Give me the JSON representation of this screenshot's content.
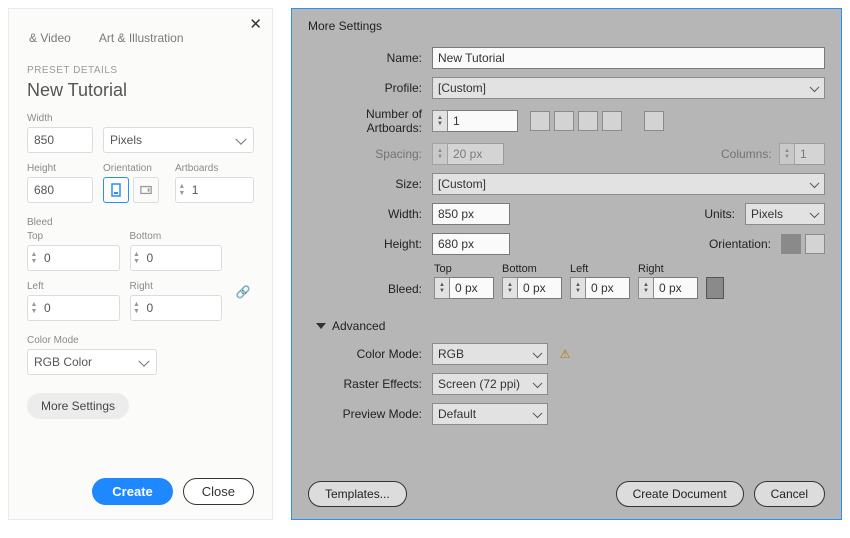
{
  "left": {
    "tabs": {
      "video": "& Video",
      "art": "Art & Illustration"
    },
    "preset_label": "PRESET DETAILS",
    "doc_name": "New Tutorial",
    "width_label": "Width",
    "width_value": "850",
    "units_value": "Pixels",
    "height_label": "Height",
    "height_value": "680",
    "orientation_label": "Orientation",
    "artboards_label": "Artboards",
    "artboards_value": "1",
    "bleed_label": "Bleed",
    "top_label": "Top",
    "top_value": "0",
    "bottom_label": "Bottom",
    "bottom_value": "0",
    "left_label": "Left",
    "left_value": "0",
    "right_label": "Right",
    "right_value": "0",
    "color_mode_label": "Color Mode",
    "color_mode_value": "RGB Color",
    "more_settings": "More Settings",
    "create_btn": "Create",
    "close_btn": "Close"
  },
  "right": {
    "title": "More Settings",
    "name_label": "Name:",
    "name_value": "New Tutorial",
    "profile_label": "Profile:",
    "profile_value": "[Custom]",
    "num_artboards_label": "Number of Artboards:",
    "num_artboards_value": "1",
    "spacing_label": "Spacing:",
    "spacing_value": "20 px",
    "columns_label": "Columns:",
    "columns_value": "1",
    "size_label": "Size:",
    "size_value": "[Custom]",
    "width_label": "Width:",
    "width_value": "850 px",
    "units_label": "Units:",
    "units_value": "Pixels",
    "height_label": "Height:",
    "height_value": "680 px",
    "orientation_label": "Orientation:",
    "bleed_label": "Bleed:",
    "top_label": "Top",
    "top_value": "0 px",
    "bottom_label": "Bottom",
    "bottom_value": "0 px",
    "left_label": "Left",
    "left_value": "0 px",
    "rright_label": "Right",
    "rright_value": "0 px",
    "advanced_label": "Advanced",
    "color_mode_label": "Color Mode:",
    "color_mode_value": "RGB",
    "raster_label": "Raster Effects:",
    "raster_value": "Screen (72 ppi)",
    "preview_label": "Preview Mode:",
    "preview_value": "Default",
    "templates_btn": "Templates...",
    "create_doc_btn": "Create Document",
    "cancel_btn": "Cancel"
  }
}
